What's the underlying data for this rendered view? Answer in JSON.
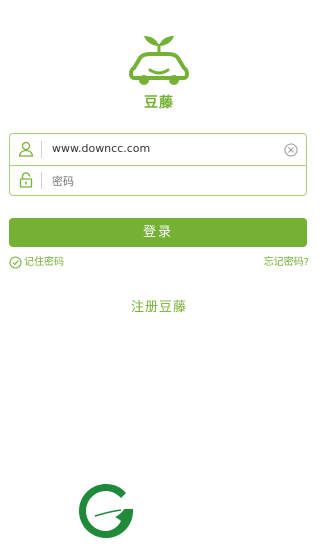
{
  "brand": {
    "name": "豆藤",
    "color": "#74b135"
  },
  "form": {
    "username": {
      "value": "www.downcc.com",
      "icon": "user-icon"
    },
    "password": {
      "placeholder": "密码",
      "icon": "lock-icon"
    }
  },
  "actions": {
    "login_label": "登录",
    "remember_label": "记住密码",
    "forgot_label": "忘记密码?",
    "register_label": "注册豆藤"
  },
  "icons": {
    "app_logo": "car-sprout-logo",
    "clear": "clear-icon",
    "check": "check-circle-icon",
    "bottom_logo": "leaf-g-logo"
  }
}
